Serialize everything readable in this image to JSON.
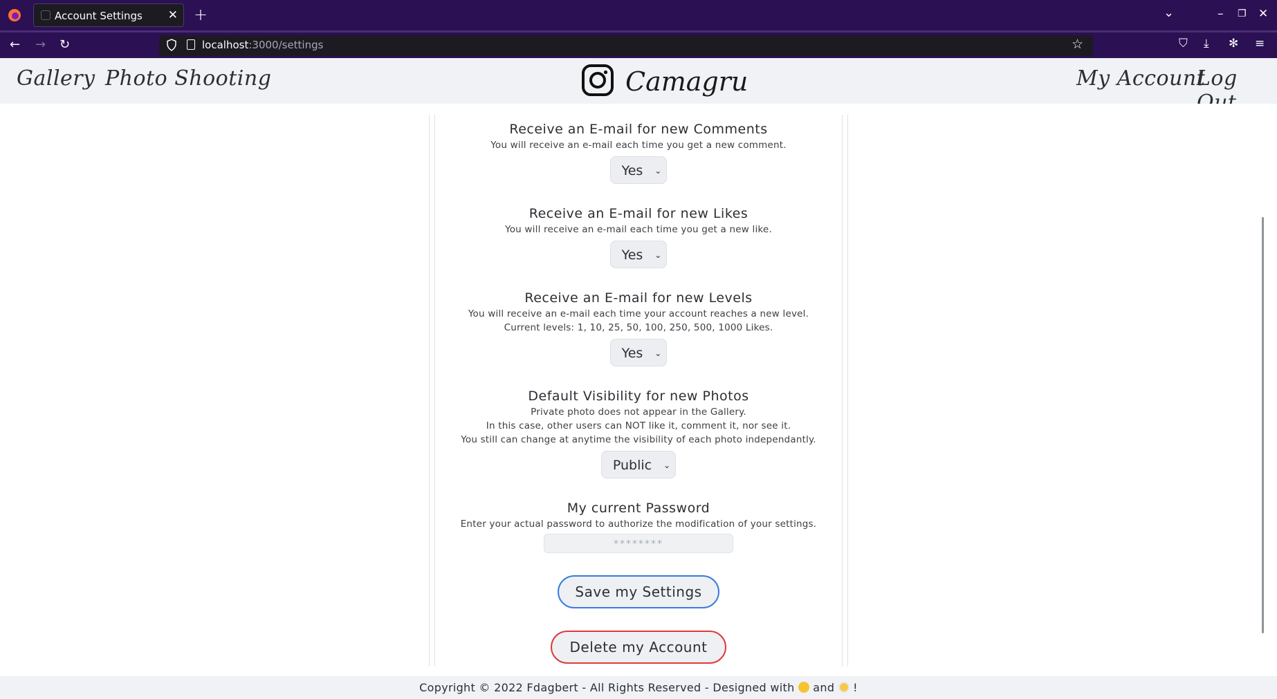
{
  "browser": {
    "tab_title": "Account Settings",
    "url_host": "localhost",
    "url_path": ":3000/settings"
  },
  "header": {
    "nav_left": [
      "Gallery",
      "Photo Shooting"
    ],
    "brand": "Camagru",
    "nav_right": [
      "My Account",
      "Log Out"
    ]
  },
  "settings": {
    "comments": {
      "title": "Receive an E-mail for new Comments",
      "desc": [
        "You will receive an e-mail each time you get a new comment."
      ],
      "value": "Yes"
    },
    "likes": {
      "title": "Receive an E-mail for new Likes",
      "desc": [
        "You will receive an e-mail each time you get a new like."
      ],
      "value": "Yes"
    },
    "levels": {
      "title": "Receive an E-mail for new Levels",
      "desc": [
        "You will receive an e-mail each time your account reaches a new level.",
        "Current levels: 1, 10, 25, 50, 100, 250, 500, 1000 Likes."
      ],
      "value": "Yes"
    },
    "visibility": {
      "title": "Default Visibility for new Photos",
      "desc": [
        "Private photo does not appear in the Gallery.",
        "In this case, other users can NOT like it, comment it, nor see it.",
        "You still can change at anytime the visibility of each photo independantly."
      ],
      "value": "Public"
    },
    "password": {
      "title": "My current Password",
      "desc": [
        "Enter your actual password to authorize the modification of your settings."
      ],
      "placeholder": "********"
    }
  },
  "buttons": {
    "save": "Save my Settings",
    "delete": "Delete my Account"
  },
  "footer": {
    "text_before": "Copyright © 2022 Fdagbert - All Rights Reserved - Designed with",
    "text_mid": "and",
    "text_end": "!",
    "emoji1": "flexed-biceps",
    "emoji2": "masked-face"
  },
  "colors": {
    "chrome_bg": "#2b1053",
    "header_bg": "#f0f2f5",
    "save_border": "#3a7be0",
    "delete_border": "#e0393b"
  }
}
